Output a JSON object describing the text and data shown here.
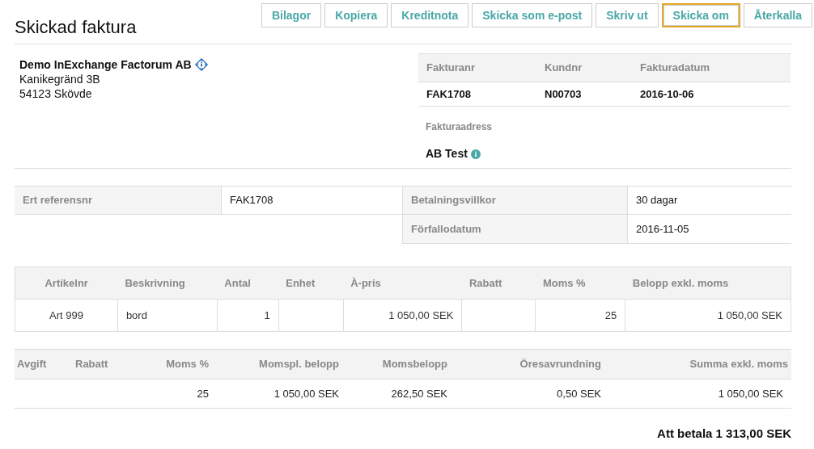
{
  "title": "Skickad faktura",
  "actions": [
    {
      "label": "Bilagor",
      "focused": false
    },
    {
      "label": "Kopiera",
      "focused": false
    },
    {
      "label": "Kreditnota",
      "focused": false
    },
    {
      "label": "Skicka som e-post",
      "focused": false
    },
    {
      "label": "Skriv ut",
      "focused": false
    },
    {
      "label": "Skicka om",
      "focused": true
    },
    {
      "label": "Återkalla",
      "focused": false
    }
  ],
  "sender": {
    "name": "Demo InExchange Factorum AB",
    "street": "Kanikegränd 3B",
    "city": "54123 Skövde"
  },
  "invoice_head": {
    "columns": [
      "Fakturanr",
      "Kundnr",
      "Fakturadatum"
    ],
    "values": [
      "FAK1708",
      "N00703",
      "2016-10-06"
    ],
    "address_label": "Fakturaadress",
    "address_name": "AB Test"
  },
  "details": [
    {
      "label": "Ert referensnr",
      "value": "FAK1708"
    },
    {
      "label": "Betalningsvillkor",
      "value": "30 dagar"
    },
    {
      "label": "Förfallodatum",
      "value": "2016-11-05"
    }
  ],
  "items": {
    "columns": [
      "Artikelnr",
      "Beskrivning",
      "Antal",
      "Enhet",
      "À-pris",
      "Rabatt",
      "Moms %",
      "Belopp exkl. moms"
    ],
    "rows": [
      [
        "Art 999",
        "bord",
        "1",
        "",
        "1 050,00 SEK",
        "",
        "25",
        "1 050,00 SEK"
      ]
    ]
  },
  "summary": {
    "columns": [
      "Avgift",
      "Rabatt",
      "Moms %",
      "Momspl. belopp",
      "Momsbelopp",
      "Öresavrundning",
      "Summa exkl. moms"
    ],
    "rows": [
      [
        "",
        "",
        "25",
        "1 050,00 SEK",
        "262,50 SEK",
        "0,50 SEK",
        "1 050,00 SEK"
      ]
    ]
  },
  "total": "Att betala 1 313,00 SEK"
}
